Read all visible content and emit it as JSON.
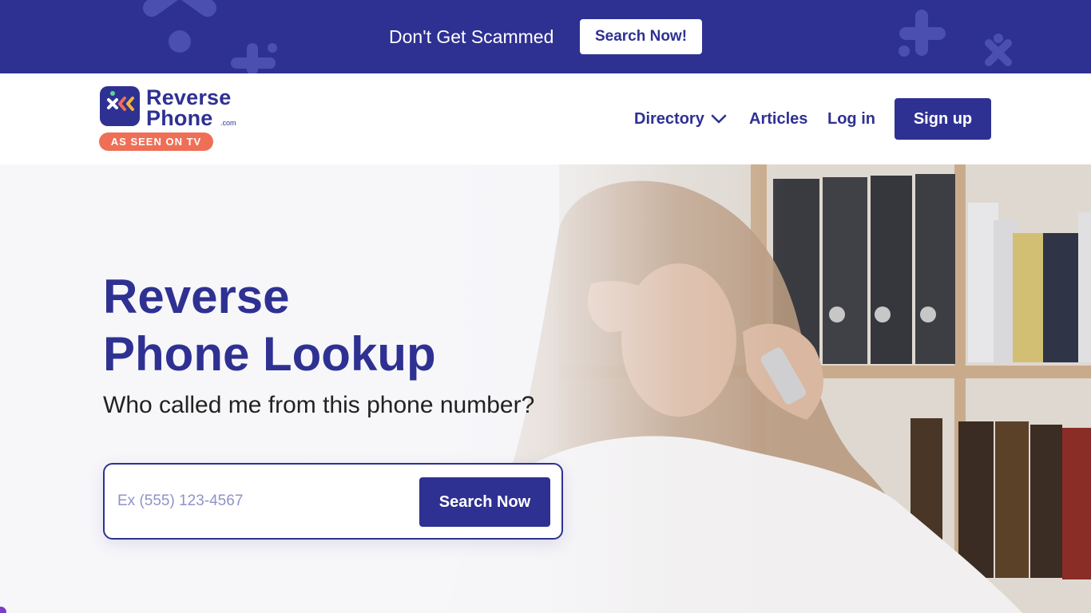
{
  "banner": {
    "text": "Don't Get Scammed",
    "button_label": "Search Now!"
  },
  "header": {
    "logo": {
      "line1": "Reverse",
      "line2": "Phone",
      "suffix": ".com",
      "badge": "AS SEEN ON TV"
    },
    "nav": {
      "directory": "Directory",
      "articles": "Articles",
      "login": "Log in",
      "signup": "Sign up"
    }
  },
  "hero": {
    "title_line1": "Reverse",
    "title_line2": "Phone Lookup",
    "subtitle": "Who called me from this phone number?",
    "search": {
      "placeholder": "Ex (555) 123-4567",
      "value": "",
      "button_label": "Search Now"
    }
  },
  "colors": {
    "brand": "#2e3192",
    "badge": "#ef6f56",
    "white": "#ffffff"
  },
  "icons": [
    "chevron-down-icon",
    "logo-mark-icon"
  ]
}
